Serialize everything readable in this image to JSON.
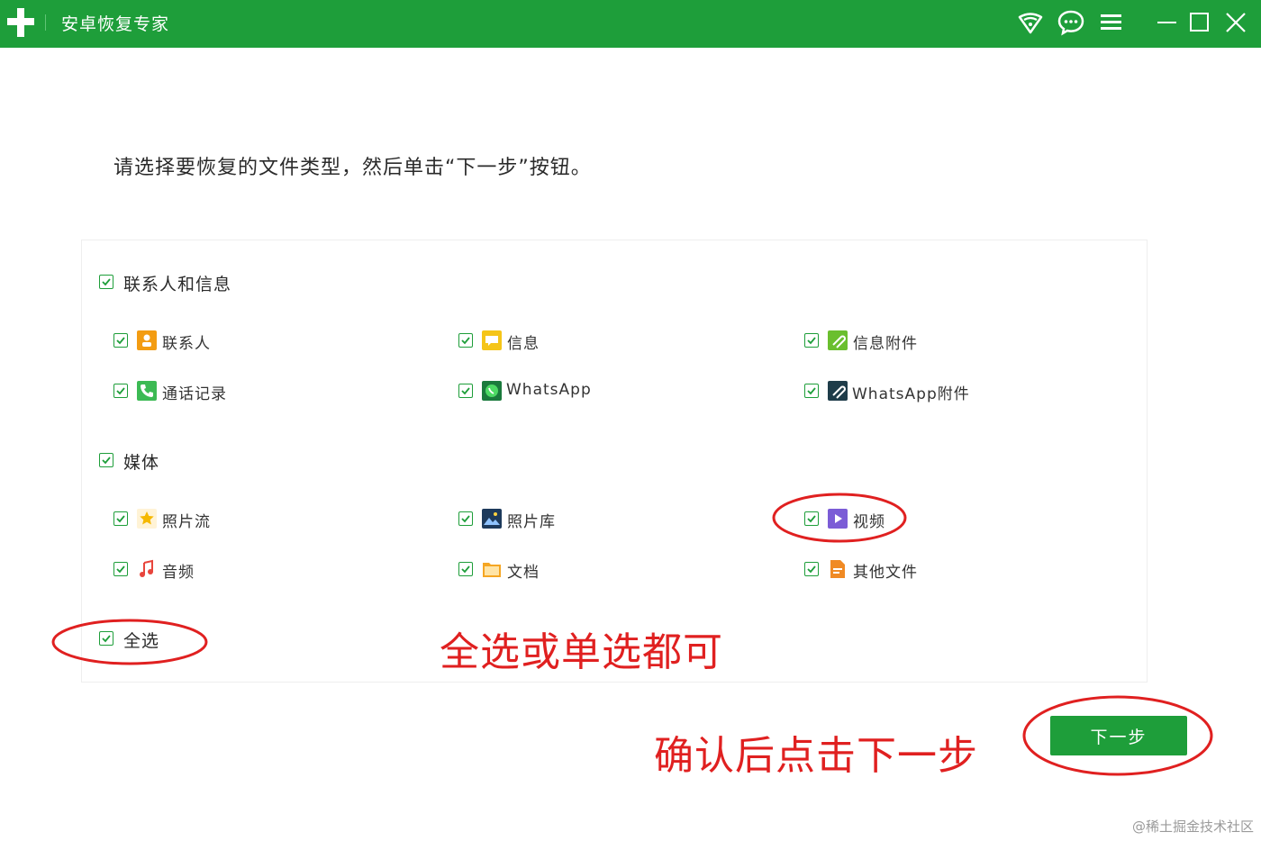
{
  "window": {
    "title": "安卓恢复专家",
    "accent_color": "#1e9e3a",
    "controls": [
      "wifi-icon",
      "chat-icon",
      "menu-icon",
      "minimize-icon",
      "maximize-icon",
      "close-icon"
    ]
  },
  "instruction": "请选择要恢复的文件类型，然后单击“下一步”按钮。",
  "groups": [
    {
      "label": "联系人和信息",
      "checked": true,
      "items": [
        {
          "label": "联系人",
          "icon": "contact-icon",
          "checked": true
        },
        {
          "label": "信息",
          "icon": "message-icon",
          "checked": true
        },
        {
          "label": "信息附件",
          "icon": "attachment-icon",
          "checked": true
        },
        {
          "label": "通话记录",
          "icon": "phone-icon",
          "checked": true
        },
        {
          "label": "WhatsApp",
          "icon": "whatsapp-icon",
          "checked": true
        },
        {
          "label": "WhatsApp附件",
          "icon": "whatsapp-attachment-icon",
          "checked": true
        }
      ]
    },
    {
      "label": "媒体",
      "checked": true,
      "items": [
        {
          "label": "照片流",
          "icon": "photostream-icon",
          "checked": true
        },
        {
          "label": "照片库",
          "icon": "photo-library-icon",
          "checked": true
        },
        {
          "label": "视频",
          "icon": "video-icon",
          "checked": true
        },
        {
          "label": "音频",
          "icon": "audio-icon",
          "checked": true
        },
        {
          "label": "文档",
          "icon": "document-icon",
          "checked": true
        },
        {
          "label": "其他文件",
          "icon": "other-file-icon",
          "checked": true
        }
      ]
    }
  ],
  "select_all": {
    "label": "全选",
    "checked": true
  },
  "annotations": {
    "select_hint": "全选或单选都可",
    "next_hint": "确认后点击下一步",
    "color": "#e02020"
  },
  "next_button": "下一步",
  "watermark": "@稀土掘金技术社区"
}
